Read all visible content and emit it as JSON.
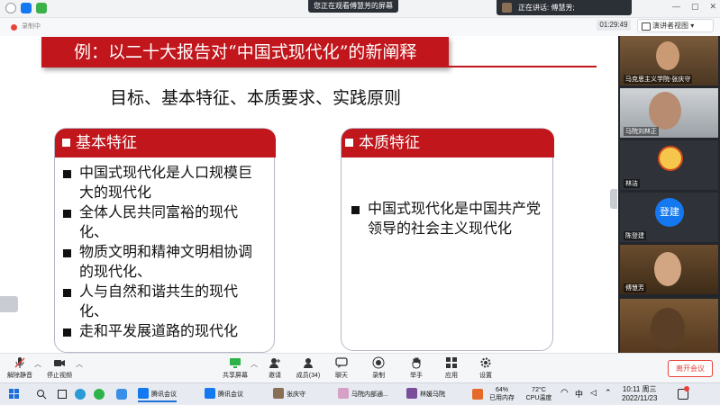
{
  "topbar": {
    "viewing_text": "您正在观看傅慧芳的屏幕",
    "speaking_text": "正在讲话: 傅慧芳;",
    "minimize": "—",
    "maximize": "▢",
    "close": "✕"
  },
  "bar2": {
    "rec_label": "录制中",
    "timer": "01:29:49",
    "view_button": "演讲者视图 ▾"
  },
  "slide": {
    "title": "例：以二十大报告对“中国式现代化”的新阐释",
    "subtitle": "目标、基本特征、本质要求、实践原则",
    "left_box": {
      "header": "基本特征",
      "items": [
        "中国式现代化是人口规模巨大的现代化",
        "全体人民共同富裕的现代化、",
        "物质文明和精神文明相协调的现代化、",
        "人与自然和谐共生的现代化、",
        "走和平发展道路的现代化"
      ]
    },
    "right_box": {
      "header": "本质特征",
      "items": [
        "中国式现代化是中国共产党领导的社会主义现代化"
      ]
    }
  },
  "participants": [
    {
      "name": "马克思主义学院-张庆守"
    },
    {
      "name": "马院刘林正"
    },
    {
      "name": "林洁"
    },
    {
      "name": "陈登建",
      "avatar_text": "登建"
    },
    {
      "name": "傅慧芳"
    },
    {
      "name": ""
    }
  ],
  "toolbar": {
    "mute": "解除静音",
    "video": "停止视频",
    "share": "共享屏幕",
    "invite": "邀请",
    "members": "成员(34)",
    "chat": "聊天",
    "record": "录制",
    "hand": "举手",
    "apps": "应用",
    "settings": "设置",
    "leave": "离开会议"
  },
  "taskbar": {
    "items": [
      "腾讯会议",
      "腾讯会议",
      "张庆守",
      "马院内部通...",
      "林媛马院"
    ],
    "memory": "64%",
    "memory_label": "已用内存",
    "cpu": "72°C",
    "cpu_label": "CPU温度",
    "time": "10:11 周三",
    "date": "2022/11/23"
  },
  "colors": {
    "accent_red": "#c0161c",
    "meeting_blue": "#1478f0"
  }
}
